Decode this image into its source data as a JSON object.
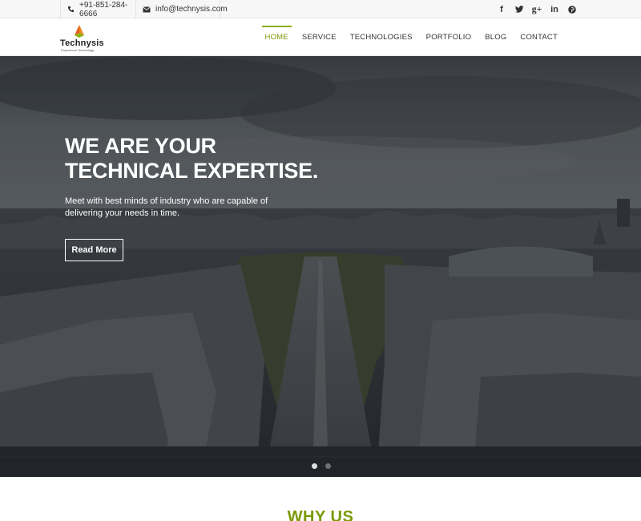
{
  "topbar": {
    "phone": "+91-851-284-6666",
    "email": "info@technysis.com",
    "social": [
      {
        "icon": "facebook-icon",
        "glyph": "f"
      },
      {
        "icon": "twitter-icon",
        "glyph": "t"
      },
      {
        "icon": "google-plus-icon",
        "glyph": "g+"
      },
      {
        "icon": "linkedin-icon",
        "glyph": "in"
      },
      {
        "icon": "pinterest-icon",
        "glyph": "p"
      }
    ]
  },
  "header": {
    "logo_name": "Technysis",
    "logo_tagline": "Experience Technology",
    "nav": [
      "HOME",
      "SERVICE",
      "TECHNOLOGIES",
      "PORTFOLIO",
      "BLOG",
      "CONTACT"
    ],
    "active_nav": "HOME"
  },
  "hero": {
    "headline_line1": "WE ARE YOUR",
    "headline_line2": "TECHNICAL EXPERTISE.",
    "subtext": "Meet with best minds of industry who are capable of delivering your needs in time.",
    "button": "Read More",
    "slides_count": 2,
    "active_slide": 1
  },
  "why_us": {
    "title": "WHY US"
  },
  "colors": {
    "accent": "#8cb011",
    "accent_text": "#7a9a01",
    "topbar_bg": "#f7f7f7"
  }
}
